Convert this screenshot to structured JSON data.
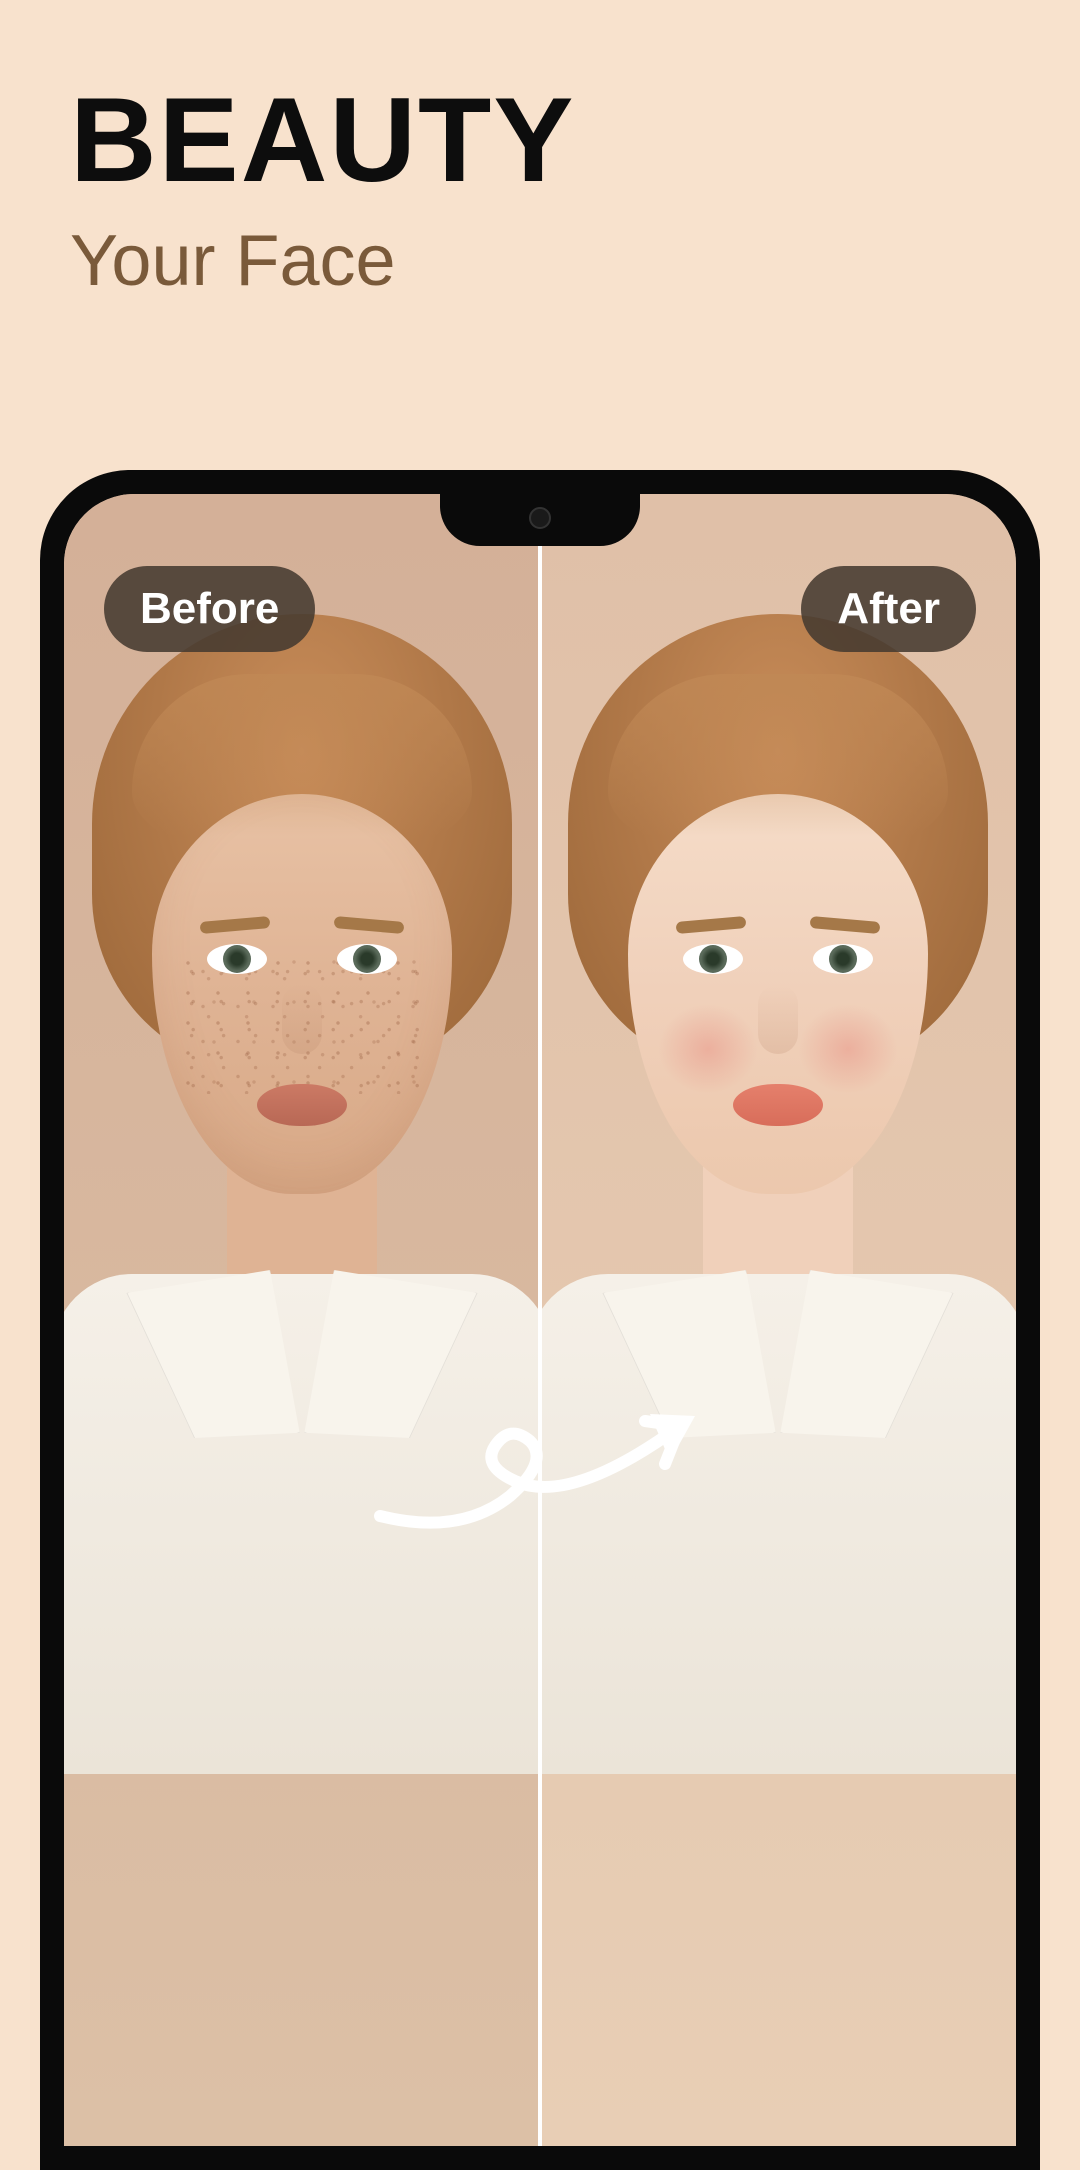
{
  "header": {
    "title": "BEAUTY",
    "subtitle": "Your Face"
  },
  "comparison": {
    "before_label": "Before",
    "after_label": "After"
  }
}
